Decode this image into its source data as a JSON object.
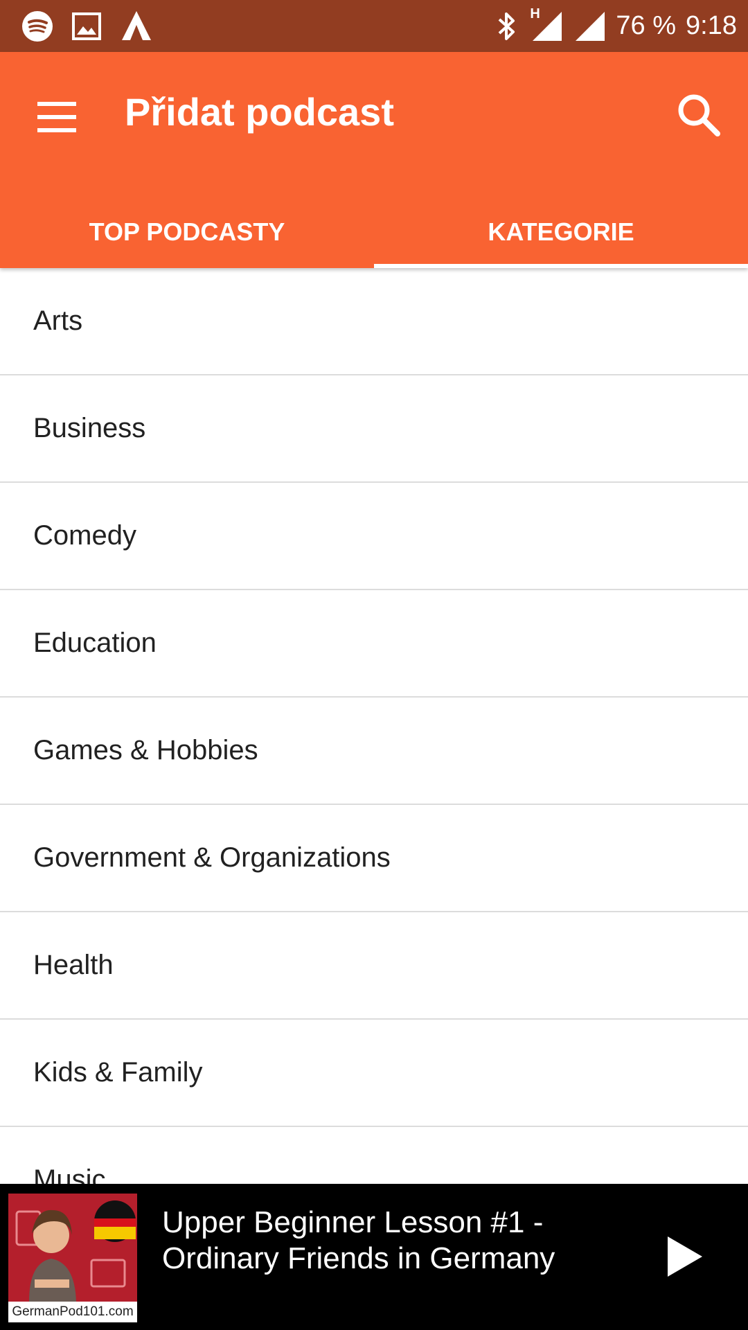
{
  "status_bar": {
    "battery": "76 %",
    "time": "9:18",
    "network_label": "H",
    "icons": [
      "spotify-icon",
      "gallery-icon",
      "arrow-app-icon",
      "bluetooth-icon",
      "signal-icon",
      "signal-icon-2"
    ]
  },
  "app_bar": {
    "title": "Přidat podcast",
    "menu_icon": "menu-icon",
    "search_icon": "search-icon",
    "color": "#f96332"
  },
  "tabs": [
    {
      "label": "TOP PODCASTY",
      "selected": false
    },
    {
      "label": "KATEGORIE",
      "selected": true
    }
  ],
  "categories": [
    "Arts",
    "Business",
    "Comedy",
    "Education",
    "Games & Hobbies",
    "Government & Organizations",
    "Health",
    "Kids & Family",
    "Music"
  ],
  "player": {
    "title": "Upper Beginner Lesson #1 - Ordinary Friends in Germany",
    "artwork_brand": "GermanPod101.com",
    "play_icon": "play-icon"
  },
  "colors": {
    "status_bar": "#923d21",
    "accent": "#f96332",
    "player_bg": "#000000"
  }
}
